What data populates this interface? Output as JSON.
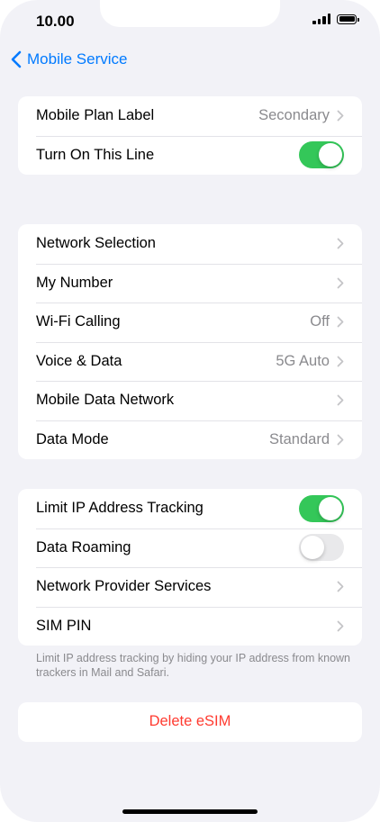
{
  "status": {
    "time": "10.00"
  },
  "nav": {
    "back_label": "Mobile Service"
  },
  "group1": [
    {
      "label": "Mobile Plan Label",
      "value": "Secondary"
    },
    {
      "label": "Turn On This Line",
      "toggle": true
    }
  ],
  "group2": [
    {
      "label": "Network Selection"
    },
    {
      "label": "My Number"
    },
    {
      "label": "Wi-Fi Calling",
      "value": "Off"
    },
    {
      "label": "Voice & Data",
      "value": "5G Auto"
    },
    {
      "label": "Mobile Data Network"
    },
    {
      "label": "Data Mode",
      "value": "Standard"
    }
  ],
  "group3": [
    {
      "label": "Limit IP Address Tracking",
      "toggle": true
    },
    {
      "label": "Data Roaming",
      "toggle": false
    },
    {
      "label": "Network Provider Services"
    },
    {
      "label": "SIM PIN"
    }
  ],
  "footnote": "Limit IP address tracking by hiding your IP address from known trackers in Mail and Safari.",
  "delete_label": "Delete eSIM",
  "colors": {
    "accent": "#007aff",
    "toggle_on": "#34c759",
    "destructive": "#ff3b30"
  },
  "icons": {
    "back": "chevron-left-icon",
    "disclosure": "chevron-right-icon"
  }
}
